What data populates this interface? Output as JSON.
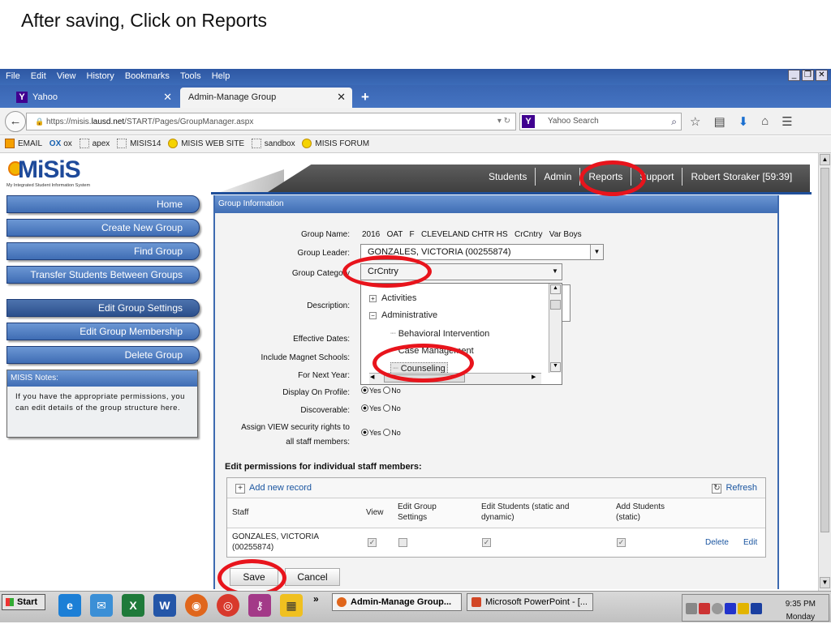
{
  "slide": {
    "title": "After saving, Click on Reports"
  },
  "browser": {
    "menu": [
      "File",
      "Edit",
      "View",
      "History",
      "Bookmarks",
      "Tools",
      "Help"
    ],
    "tabs": [
      {
        "label": "Yahoo",
        "active": false
      },
      {
        "label": "Admin-Manage Group",
        "active": true
      }
    ],
    "url_prefix": "https://misis.",
    "url_domain": "lausd.net",
    "url_path": "/START/Pages/GroupManager.aspx",
    "search_placeholder": "Yahoo Search",
    "bookmarks": [
      "EMAIL",
      "ox",
      "apex",
      "MISIS14",
      "MISIS WEB SITE",
      "sandbox",
      "MISIS FORUM"
    ],
    "bookmark_ox_badge": "OX"
  },
  "app": {
    "logo": "MiSiS",
    "logo_sub": "My Integrated Student Information System",
    "topnav": [
      "Students",
      "Admin",
      "Reports",
      "Support",
      "Robert Storaker [59:39]"
    ],
    "leftnav": [
      "Home",
      "Create New Group",
      "Find Group",
      "Transfer Students Between Groups",
      "Edit Group Settings",
      "Edit Group Membership",
      "Delete Group"
    ],
    "notes_title": "MISIS Notes:",
    "notes_body": "If you have the appropriate permissions, you can edit details of the group structure here."
  },
  "form": {
    "header": "Group Information",
    "labels": {
      "name": "Group Name:",
      "leader": "Group Leader:",
      "category": "Group Category",
      "description": "Description:",
      "effective": "Effective Dates:",
      "magnet": "Include Magnet Schools:",
      "next_year": "For Next Year:",
      "display": "Display On Profile:",
      "discoverable": "Discoverable:",
      "assign1": "Assign VIEW security rights to",
      "assign2": "all staff members:"
    },
    "group_name": "2016   OAT   F   CLEVELAND CHTR HS   CrCntry   Var Boys",
    "leader": "GONZALES, VICTORIA (00255874)",
    "category": "CrCntry",
    "tree": {
      "activities": "Activities",
      "administrative": "Administrative",
      "behavioral": "Behavioral Intervention",
      "case": "Case Management",
      "counseling": "Counseling"
    },
    "yes": "Yes",
    "no": "No"
  },
  "permissions": {
    "title": "Edit permissions for individual staff members:",
    "add": "Add new record",
    "refresh": "Refresh",
    "columns": {
      "staff": "Staff",
      "view": "View",
      "edit_settings": "Edit Group Settings",
      "edit_students": "Edit Students (static and dynamic)",
      "add_students": "Add Students (static)"
    },
    "row": {
      "staff": "GONZALES, VICTORIA (00255874)",
      "delete": "Delete",
      "edit": "Edit"
    }
  },
  "buttons": {
    "save": "Save",
    "cancel": "Cancel"
  },
  "taskbar": {
    "start": "Start",
    "firefox_task": "Admin-Manage Group...",
    "ppt_task": "Microsoft PowerPoint - [...",
    "time": "9:35 PM",
    "day": "Monday",
    "more": "»"
  },
  "colors": {
    "highlight_ring": "#e8141c",
    "nav_blue": "#3f6db4"
  }
}
